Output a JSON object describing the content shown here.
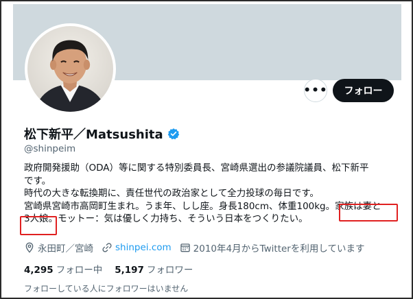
{
  "profile": {
    "display_name": "松下新平／Matsushita",
    "handle": "@shinpeim",
    "verified": true,
    "avatar": "portrait-photo",
    "bio_lines": [
      "政府開発援助（ODA）等に関する特別委員長、宮崎県選出の参議院議員、松下新平",
      "です。",
      "時代の大きな転換期に、責任世代の政治家として全力投球の毎日です。",
      "宮崎県宮崎市高岡町生まれ。うま年、しし座。身長180cm、体重100kg。家族は妻と",
      "3人娘。モットー：気は優しく力持ち、そういう日本をつくりたい。"
    ],
    "location": "永田町／宮崎",
    "website": "shinpei.com",
    "joined": "2010年4月からTwitterを利用しています",
    "following_count": "4,295",
    "following_label": "フォロー中",
    "followers_count": "5,197",
    "followers_label": "フォロワー",
    "followers_you_know": "フォローしている人にフォロワーはいません"
  },
  "actions": {
    "more_label": "•••",
    "follow_label": "フォロー"
  },
  "colors": {
    "accent": "#1d9bf0",
    "banner": "#cfd9de",
    "highlight": "#e02020",
    "button": "#0f1419"
  }
}
